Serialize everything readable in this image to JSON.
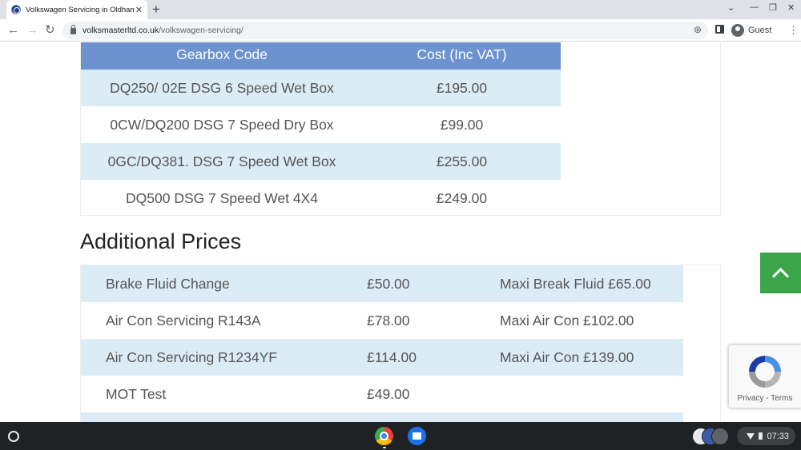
{
  "browser": {
    "tab_title": "Volkswagen Servicing in Oldham",
    "tab_close": "✕",
    "new_tab": "+",
    "url_host": "volksmasterltd.co.uk",
    "url_path": "/volkswagen-servicing/",
    "profile_label": "Guest"
  },
  "gearbox_table": {
    "headers": [
      "Gearbox Code",
      "Cost (Inc VAT)"
    ],
    "rows": [
      [
        "DQ250/ 02E DSG 6 Speed Wet Box",
        "£195.00"
      ],
      [
        "0CW/DQ200 DSG 7 Speed Dry Box",
        "£99.00"
      ],
      [
        "0GC/DQ381. DSG 7 Speed Wet Box",
        "£255.00"
      ],
      [
        "DQ500 DSG 7 Speed Wet 4X4",
        "£249.00"
      ]
    ]
  },
  "additional": {
    "title": "Additional Prices",
    "rows": [
      [
        "Brake Fluid Change",
        "£50.00",
        "Maxi Break Fluid £65.00"
      ],
      [
        "Air Con Servicing R143A",
        "£78.00",
        "Maxi Air Con £102.00"
      ],
      [
        "Air Con Servicing R1234YF",
        "£114.00",
        "Maxi Air Con £139.00"
      ],
      [
        "MOT Test",
        "£49.00",
        ""
      ],
      [
        "",
        "",
        ""
      ]
    ]
  },
  "recaptcha": {
    "privacy": "Privacy",
    "separator": " - ",
    "terms": "Terms"
  },
  "shelf": {
    "time": "07:33"
  },
  "colors": {
    "table_header": "#6c92d0",
    "row_alt": "#dbecf7",
    "scroll_top": "#3aa54a"
  }
}
